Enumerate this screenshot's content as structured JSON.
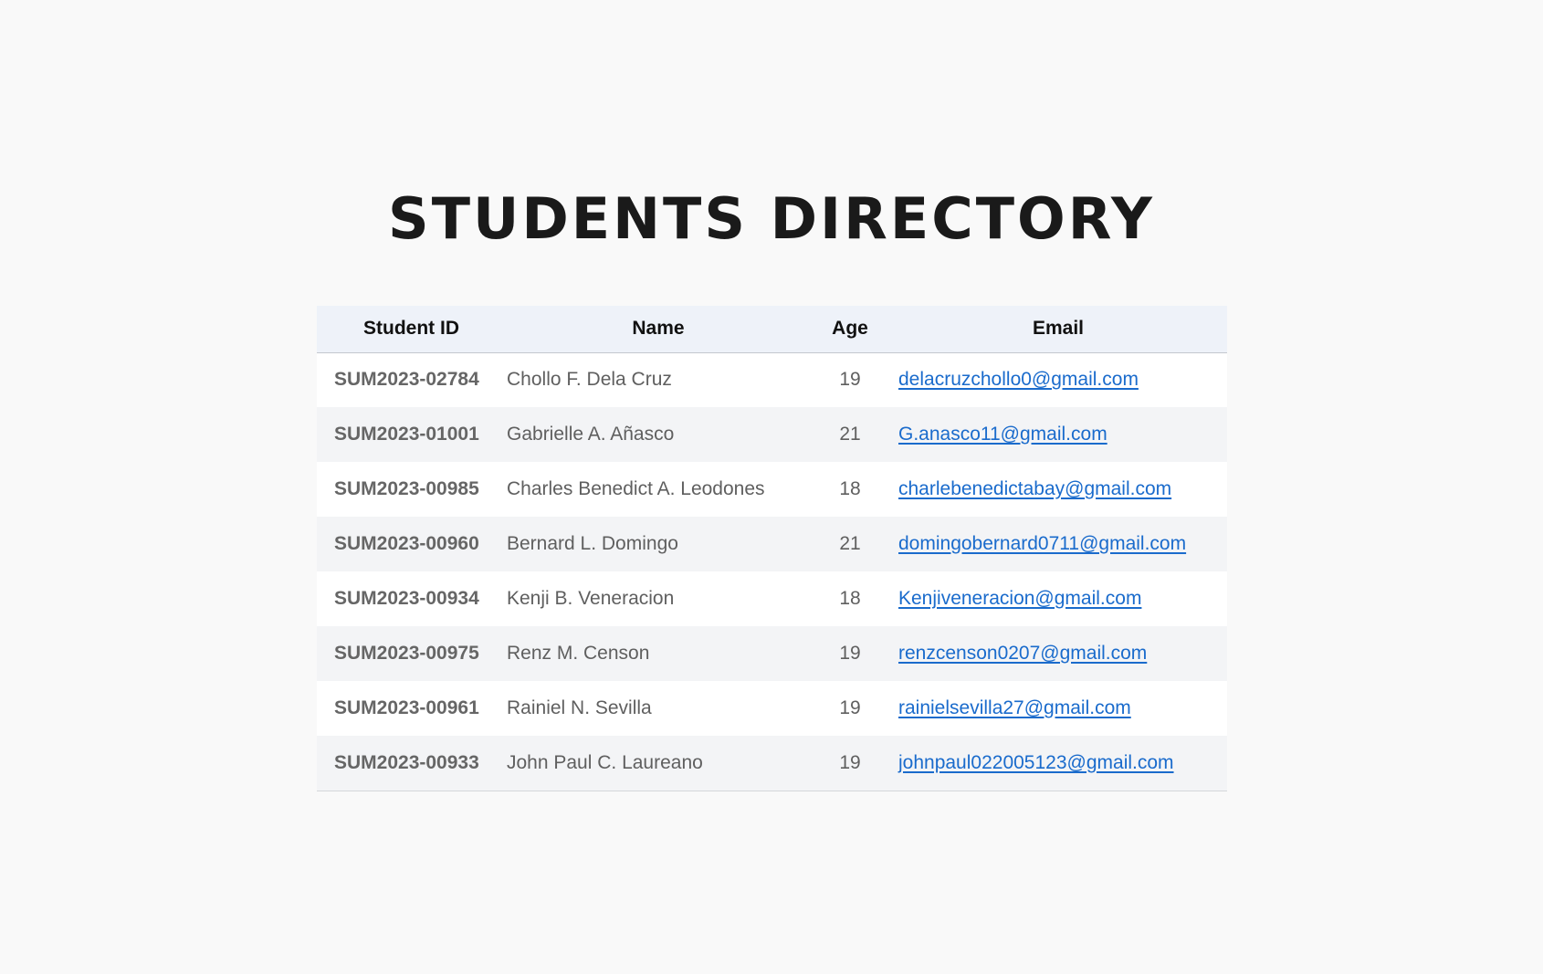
{
  "page": {
    "title": "STUDENTS DIRECTORY"
  },
  "table": {
    "headers": {
      "student_id": "Student ID",
      "name": "Name",
      "age": "Age",
      "email": "Email"
    },
    "rows": [
      {
        "student_id": "SUM2023-02784",
        "name": "Chollo F. Dela Cruz",
        "age": "19",
        "email": "delacruzchollo0@gmail.com"
      },
      {
        "student_id": "SUM2023-01001",
        "name": "Gabrielle A. Añasco",
        "age": "21",
        "email": "G.anasco11@gmail.com"
      },
      {
        "student_id": "SUM2023-00985",
        "name": "Charles Benedict A. Leodones",
        "age": "18",
        "email": "charlebenedictabay@gmail.com"
      },
      {
        "student_id": "SUM2023-00960",
        "name": "Bernard L. Domingo",
        "age": "21",
        "email": "domingobernard0711@gmail.com"
      },
      {
        "student_id": "SUM2023-00934",
        "name": "Kenji B. Veneracion",
        "age": "18",
        "email": "Kenjiveneracion@gmail.com"
      },
      {
        "student_id": "SUM2023-00975",
        "name": "Renz M. Censon",
        "age": "19",
        "email": "renzcenson0207@gmail.com"
      },
      {
        "student_id": "SUM2023-00961",
        "name": "Rainiel N. Sevilla",
        "age": "19",
        "email": "rainielsevilla27@gmail.com"
      },
      {
        "student_id": "SUM2023-00933",
        "name": "John Paul C. Laureano",
        "age": "19",
        "email": "johnpaul022005123@gmail.com"
      }
    ]
  },
  "colors": {
    "background": "#f9f9f9",
    "header_background": "#eef2f9",
    "row_alt_background": "#f3f4f6",
    "link": "#1a6bcc"
  }
}
